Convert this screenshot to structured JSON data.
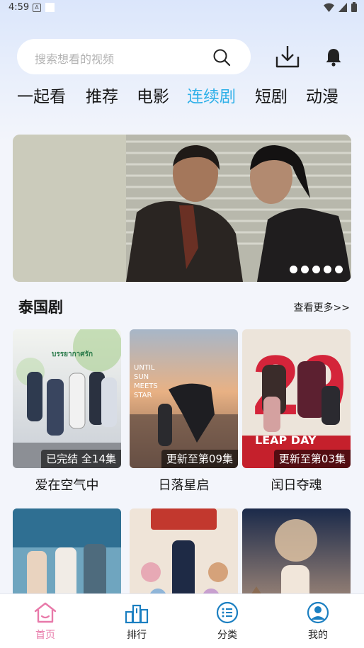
{
  "status_bar": {
    "time": "4:59",
    "a_icon": "A"
  },
  "search": {
    "placeholder": "搜索想看的视频"
  },
  "tabs": [
    {
      "label": "一起看",
      "active": false
    },
    {
      "label": "推荐",
      "active": false
    },
    {
      "label": "电影",
      "active": false
    },
    {
      "label": "连续剧",
      "active": true
    },
    {
      "label": "短剧",
      "active": false
    },
    {
      "label": "动漫",
      "active": false
    }
  ],
  "banner": {
    "dots_count": 5
  },
  "section": {
    "title": "泰国剧",
    "more": "查看更多>>"
  },
  "cards": [
    {
      "badge": "已完结 全14集",
      "title": "爱在空气中",
      "poster_caption": "บรรยากาศรัก"
    },
    {
      "badge": "更新至第09集",
      "title": "日落星启",
      "poster_caption": "UNTIL SUN MEETS STAR"
    },
    {
      "badge": "更新至第03集",
      "title": "闰日夺魂",
      "poster_caption": "LEAP DAY"
    },
    {
      "badge": "",
      "title": "",
      "poster_caption": ""
    },
    {
      "badge": "",
      "title": "",
      "poster_caption": ""
    },
    {
      "badge": "",
      "title": "",
      "poster_caption": ""
    }
  ],
  "bottom_nav": [
    {
      "label": "首页",
      "icon": "home-icon",
      "active": true
    },
    {
      "label": "排行",
      "icon": "ranking-icon",
      "active": false
    },
    {
      "label": "分类",
      "icon": "category-icon",
      "active": false
    },
    {
      "label": "我的",
      "icon": "profile-icon",
      "active": false
    }
  ],
  "colors": {
    "accent": "#2fb0e8",
    "nav_active": "#e879a9"
  }
}
